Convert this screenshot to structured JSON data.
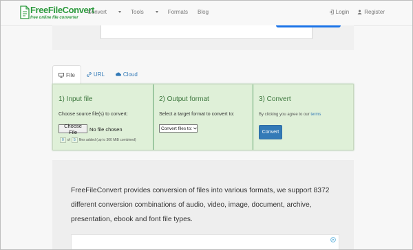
{
  "brand": {
    "name": "FreeFileConvert",
    "tagline": "free online file converter"
  },
  "nav": {
    "items": [
      {
        "label": "Convert",
        "has_dropdown": true
      },
      {
        "label": "Tools",
        "has_dropdown": true
      },
      {
        "label": "Formats",
        "has_dropdown": false
      },
      {
        "label": "Blog",
        "has_dropdown": false
      }
    ],
    "login": "Login",
    "register": "Register"
  },
  "tabs": [
    {
      "label": "File",
      "icon": "monitor-icon",
      "active": true
    },
    {
      "label": "URL",
      "icon": "link-icon",
      "active": false
    },
    {
      "label": "Cloud",
      "icon": "cloud-icon",
      "active": false
    }
  ],
  "steps": {
    "input": {
      "title": "1) Input file",
      "description": "Choose source file(s) to convert:",
      "choose_label": "Choose File",
      "no_file": "No file chosen",
      "count_current": "0",
      "count_of": "of",
      "count_max": "5",
      "count_suffix": "files added (up to 300 MiB combined)"
    },
    "output": {
      "title": "2) Output format",
      "description": "Select a target format to convert to:",
      "select_value": "Convert files to:"
    },
    "convert": {
      "title": "3) Convert",
      "agree_prefix": "By clicking you agree to our",
      "terms_link": "terms",
      "button_label": "Convert"
    }
  },
  "description": "FreeFileConvert provides conversion of files into various formats, we support 8372 different conversion combinations of audio, video, image, document, archive, presentation, ebook and font file types.",
  "colors": {
    "brand_green": "#2d9a3e",
    "panel_bg": "#dff0d8",
    "step_title": "#3c763d",
    "link_blue": "#337ab7",
    "button_blue": "#337ab7"
  }
}
